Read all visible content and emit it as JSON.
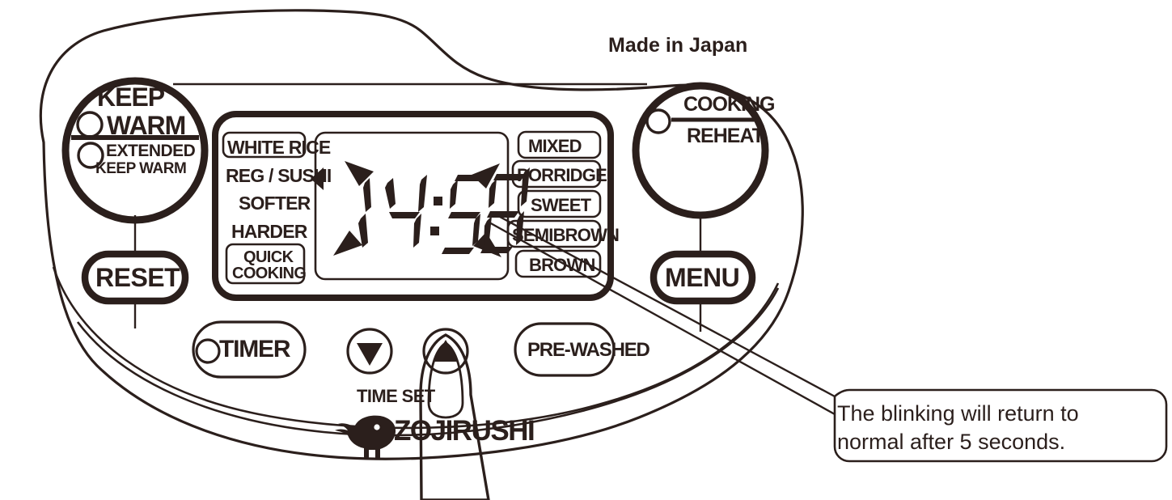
{
  "device": {
    "brand": "ZOJIRUSHI",
    "origin_label": "Made in Japan"
  },
  "buttons": {
    "keep_warm": {
      "line1": "KEEP",
      "line2": "WARM",
      "line3": "EXTENDED",
      "line4": "KEEP WARM"
    },
    "reset": "RESET",
    "menu": "MENU",
    "cooking": "COOKING",
    "reheat": "REHEAT",
    "timer": "TIMER",
    "pre_washed": "PRE-WASHED",
    "time_set": "TIME SET",
    "arrow_down": "▼",
    "arrow_up": "▲"
  },
  "lcd": {
    "value": "14:58",
    "segment_text": "14:58",
    "left_labels": [
      "WHITE RICE",
      "REG / SUSHI",
      "SOFTER",
      "HARDER",
      "QUICK",
      "COOKING"
    ],
    "right_labels": [
      "MIXED",
      "PORRIDGE",
      "SWEET",
      "SEMIBROWN",
      "BROWN"
    ],
    "indicator": "◀"
  },
  "callout": {
    "line1": "The blinking will return to",
    "line2": "normal after 5 seconds."
  },
  "colors": {
    "ink": "#2b1f1c",
    "panel": "#ffffff"
  }
}
